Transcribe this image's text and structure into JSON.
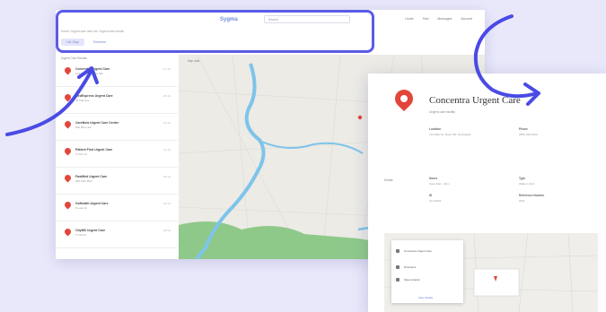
{
  "back_window": {
    "brand": "Sygma",
    "search_placeholder": "Search",
    "nav": [
      "Home",
      "Find",
      "Messages",
      "Account"
    ],
    "breadcrumb": "Home / Urgent care near me / Urgent care results",
    "tabs": [
      "List / Map",
      "Directions"
    ],
    "list_header": "Urgent Care Results",
    "results": [
      {
        "title": "Concentra Urgent Care",
        "address": "123 Main St, Suite 100",
        "distance": "1.2 mi"
      },
      {
        "title": "MedExpress Urgent Care",
        "address": "45 Oak Ave",
        "distance": "2.0 mi"
      },
      {
        "title": "CareNow Urgent Care Center",
        "address": "900 River Rd",
        "distance": "2.4 mi"
      },
      {
        "title": "Patient First Urgent Care",
        "address": "17 Elm St",
        "distance": "3.1 mi"
      },
      {
        "title": "FastMed Urgent Care",
        "address": "250 Park Blvd",
        "distance": "3.6 mi"
      },
      {
        "title": "GoHealth Urgent Care",
        "address": "8 Lake Dr",
        "distance": "4.0 mi"
      },
      {
        "title": "CityMD Urgent Care",
        "address": "77 Hill St",
        "distance": "4.8 mi"
      }
    ],
    "map_label": "Map data",
    "pins": 9
  },
  "card": {
    "title": "Concentra Urgent Care",
    "subtitle": "Urgent care facility",
    "side_label": "Details",
    "fields": [
      {
        "label": "Location",
        "value": "123 Main St, Suite 100, Springfield"
      },
      {
        "label": "Phone",
        "value": "(555) 010-2200"
      },
      {
        "label": "Hours",
        "value": "Open 8am - 8pm"
      },
      {
        "label": "Type",
        "value": "Walk-in clinic"
      },
      {
        "label": "ID",
        "value": "UC-00421"
      },
      {
        "label": "Reference Number",
        "value": "2021"
      }
    ],
    "popup": {
      "title": "Concentra Urgent Care",
      "lines": [
        "Directions",
        "Save location"
      ],
      "link": "View details"
    }
  },
  "colors": {
    "background": "#e9e8fb",
    "accent": "#5b5be8",
    "pin": "#e2463a",
    "river": "#7ec4ea",
    "park": "#8fc98a"
  }
}
